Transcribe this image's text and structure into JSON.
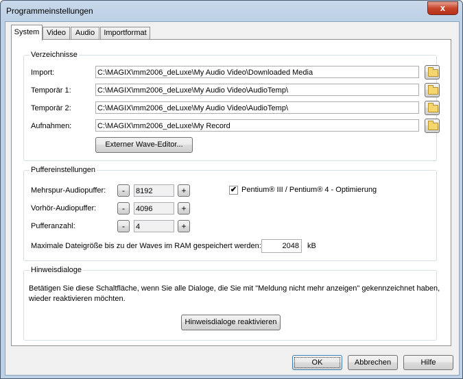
{
  "window": {
    "title": "Programmeinstellungen",
    "close_glyph": "x"
  },
  "tabs": [
    "System",
    "Video",
    "Audio",
    "Importformat"
  ],
  "verzeichnisse": {
    "legend": "Verzeichnisse",
    "rows": [
      {
        "label": "Import:",
        "value": "C:\\MAGIX\\mm2006_deLuxe\\My Audio Video\\Downloaded Media"
      },
      {
        "label": "Temporär 1:",
        "value": "C:\\MAGIX\\mm2006_deLuxe\\My Audio Video\\AudioTemp\\"
      },
      {
        "label": "Temporär 2:",
        "value": "C:\\MAGIX\\mm2006_deLuxe\\My Audio Video\\AudioTemp\\"
      },
      {
        "label": "Aufnahmen:",
        "value": "C:\\MAGIX\\mm2006_deLuxe\\My Record"
      }
    ],
    "wave_editor_button": "Externer Wave-Editor..."
  },
  "puffer": {
    "legend": "Puffereinstellungen",
    "rows": [
      {
        "label": "Mehrspur-Audiopuffer:",
        "value": "8192"
      },
      {
        "label": "Vorhör-Audiopuffer:",
        "value": "4096"
      },
      {
        "label": "Pufferanzahl:",
        "value": "4"
      }
    ],
    "minus": "-",
    "plus": "+",
    "pentium_label": "Pentium® III / Pentium® 4 - Optimierung",
    "pentium_checked": true,
    "check_glyph": "✔",
    "max_label": "Maximale Dateigröße bis zu der Waves im RAM gespeichert werden:",
    "max_value": "2048",
    "max_unit": "kB"
  },
  "hinweis": {
    "legend": "Hinweisdialoge",
    "text1": "Betätigen Sie diese Schaltfläche, wenn Sie alle Dialoge, die Sie mit \"Meldung nicht mehr anzeigen\" gekennzeichnet haben,",
    "text2": "wieder reaktivieren möchten.",
    "button": "Hinweisdialoge reaktivieren"
  },
  "footer": {
    "ok": "OK",
    "cancel": "Abbrechen",
    "help": "Hilfe"
  }
}
